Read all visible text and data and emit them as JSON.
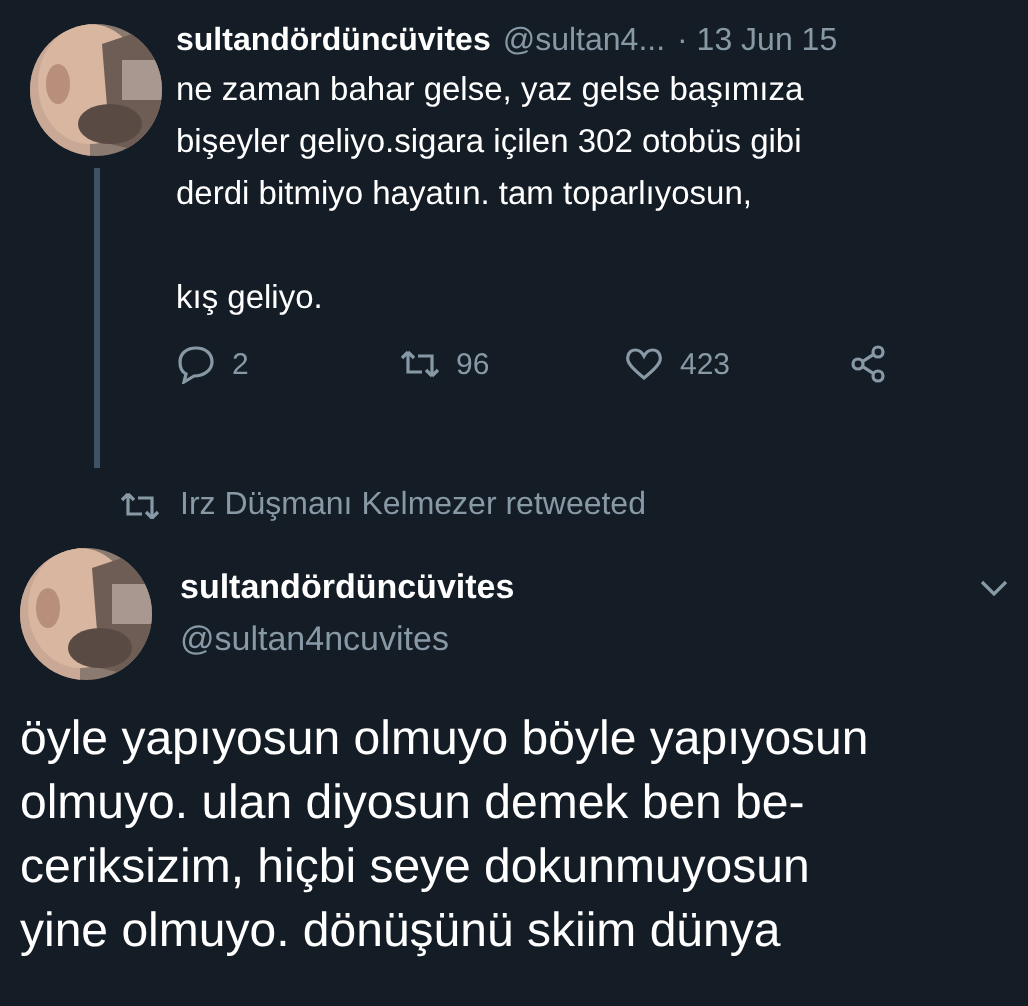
{
  "tweets": [
    {
      "kind": "reply",
      "name": "sultandördüncüvites",
      "handle": "@sultan4...",
      "time": "· 13 Jun 15",
      "text": "ne zaman bahar gelse, yaz gelse başımıza\nbişeyler geliyo.sigara içilen 302 otobüs gibi\nderdi bitmiyo hayatın. tam toparlıyosun,\n\nkış geliyo.",
      "replies": "2",
      "retweets": "96",
      "likes": "423"
    },
    {
      "kind": "main",
      "retweeted_by": "Irz Düşmanı Kelmezer retweeted",
      "name": "sultandördüncüvites",
      "handle": "@sultan4ncuvites",
      "text": "öyle yapıyosun olmuyo böyle yapıyosun\nolmuyo. ulan diyosun demek ben be-\nceriksizim, hiçbi seye dokunmuyosun\nyine olmuyo. dönüşünü skiim dünya"
    }
  ]
}
